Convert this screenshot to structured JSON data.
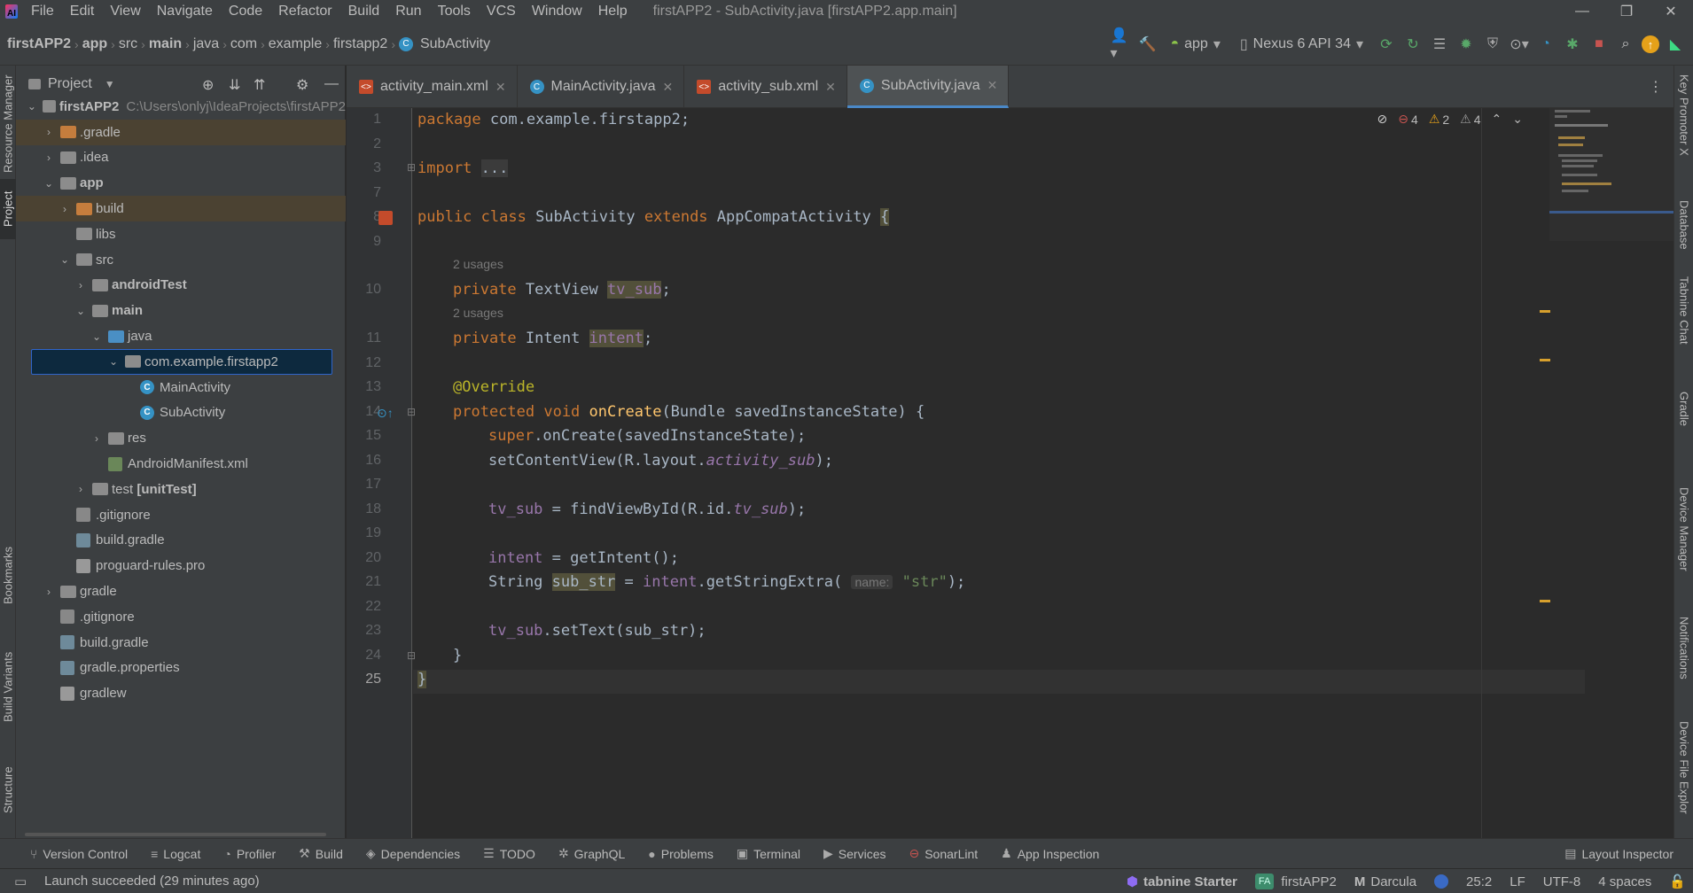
{
  "window": {
    "title": "firstAPP2 - SubActivity.java [firstAPP2.app.main]",
    "controls": {
      "minimize": "—",
      "maximize": "❐",
      "close": "✕"
    }
  },
  "menu": [
    "File",
    "Edit",
    "View",
    "Navigate",
    "Code",
    "Refactor",
    "Build",
    "Run",
    "Tools",
    "VCS",
    "Window",
    "Help"
  ],
  "breadcrumb": [
    "firstAPP2",
    "app",
    "src",
    "main",
    "java",
    "com",
    "example",
    "firstapp2",
    "SubActivity"
  ],
  "toolbar": {
    "run_config": "app",
    "device": "Nexus 6 API 34"
  },
  "left_stripe": {
    "resource_manager": "Resource Manager",
    "project": "Project",
    "bookmarks": "Bookmarks",
    "build_variants": "Build Variants",
    "structure": "Structure"
  },
  "right_stripe": {
    "key_promoter": "Key Promoter X",
    "database": "Database",
    "tabnine_chat": "Tabnine Chat",
    "gradle": "Gradle",
    "device_manager": "Device Manager",
    "notifications": "Notifications",
    "device_file_explorer": "Device File Explor"
  },
  "project_panel": {
    "title": "Project",
    "root_path": "C:\\Users\\onlyj\\IdeaProjects\\firstAPP2",
    "tree": [
      {
        "label": "firstAPP2",
        "depth": 0,
        "arrow": "⌄",
        "icon": "folder-gray",
        "bold": true
      },
      {
        "label": ".gradle",
        "depth": 1,
        "arrow": "›",
        "icon": "folder-orange",
        "excluded": true
      },
      {
        "label": ".idea",
        "depth": 1,
        "arrow": "›",
        "icon": "folder-gray"
      },
      {
        "label": "app",
        "depth": 1,
        "arrow": "⌄",
        "icon": "folder-gray",
        "bold": true
      },
      {
        "label": "build",
        "depth": 2,
        "arrow": "›",
        "icon": "folder-orange",
        "excluded": true
      },
      {
        "label": "libs",
        "depth": 2,
        "arrow": "",
        "icon": "folder-gray"
      },
      {
        "label": "src",
        "depth": 2,
        "arrow": "⌄",
        "icon": "folder-gray"
      },
      {
        "label": "androidTest",
        "depth": 3,
        "arrow": "›",
        "icon": "folder-gray",
        "bold": true
      },
      {
        "label": "main",
        "depth": 3,
        "arrow": "⌄",
        "icon": "folder-gray",
        "bold": true
      },
      {
        "label": "java",
        "depth": 4,
        "arrow": "⌄",
        "icon": "folder-blue"
      },
      {
        "label": "com.example.firstapp2",
        "depth": 5,
        "arrow": "⌄",
        "icon": "folder-pkg",
        "selected": true
      },
      {
        "label": "MainActivity",
        "depth": 6,
        "arrow": "",
        "icon": "class"
      },
      {
        "label": "SubActivity",
        "depth": 6,
        "arrow": "",
        "icon": "class"
      },
      {
        "label": "res",
        "depth": 4,
        "arrow": "›",
        "icon": "folder-gray"
      },
      {
        "label": "AndroidManifest.xml",
        "depth": 4,
        "arrow": "",
        "icon": "xml"
      },
      {
        "label": "test [unitTest]",
        "depth": 3,
        "arrow": "›",
        "icon": "folder-gray",
        "bold_suffix": true
      },
      {
        "label": ".gitignore",
        "depth": 2,
        "arrow": "",
        "icon": "git"
      },
      {
        "label": "build.gradle",
        "depth": 2,
        "arrow": "",
        "icon": "gradle"
      },
      {
        "label": "proguard-rules.pro",
        "depth": 2,
        "arrow": "",
        "icon": "txt"
      },
      {
        "label": "gradle",
        "depth": 1,
        "arrow": "›",
        "icon": "folder-gray"
      },
      {
        "label": ".gitignore",
        "depth": 1,
        "arrow": "",
        "icon": "git"
      },
      {
        "label": "build.gradle",
        "depth": 1,
        "arrow": "",
        "icon": "gradle"
      },
      {
        "label": "gradle.properties",
        "depth": 1,
        "arrow": "",
        "icon": "gradle"
      },
      {
        "label": "gradlew",
        "depth": 1,
        "arrow": "",
        "icon": "txt"
      }
    ]
  },
  "editor_tabs": [
    {
      "label": "activity_main.xml",
      "type": "xml",
      "active": false
    },
    {
      "label": "MainActivity.java",
      "type": "class",
      "active": false
    },
    {
      "label": "activity_sub.xml",
      "type": "xml",
      "active": false
    },
    {
      "label": "SubActivity.java",
      "type": "class",
      "active": true
    }
  ],
  "inspection": {
    "errors": "4",
    "warnings": "2",
    "weak_warnings": "4"
  },
  "code": {
    "line_numbers": [
      "1",
      "2",
      "3",
      "7",
      "8",
      "9",
      "10",
      "11",
      "12",
      "13",
      "14",
      "15",
      "16",
      "17",
      "18",
      "19",
      "20",
      "21",
      "22",
      "23",
      "24",
      "25"
    ],
    "current_line": "25",
    "usages_hint": "2 usages",
    "inlay_name": "name:"
  },
  "bottom_tools": [
    "Version Control",
    "Logcat",
    "Profiler",
    "Build",
    "Dependencies",
    "TODO",
    "GraphQL",
    "Problems",
    "Terminal",
    "Services",
    "SonarLint",
    "App Inspection"
  ],
  "layout_inspector": "Layout Inspector",
  "status": {
    "message": "Launch succeeded (29 minutes ago)",
    "tabnine": "tabnine Starter",
    "project_badge": "FA",
    "project": "firstAPP2",
    "theme": "Darcula",
    "position": "25:2",
    "line_sep": "LF",
    "encoding": "UTF-8",
    "indent": "4 spaces"
  },
  "colors": {
    "bg": "#2b2b2b",
    "panel": "#3c3f41",
    "keyword": "#cc7832",
    "annotation": "#bbb529",
    "method": "#ffc66d",
    "field": "#9876aa",
    "string": "#6a8759",
    "accent": "#4a88c7"
  }
}
